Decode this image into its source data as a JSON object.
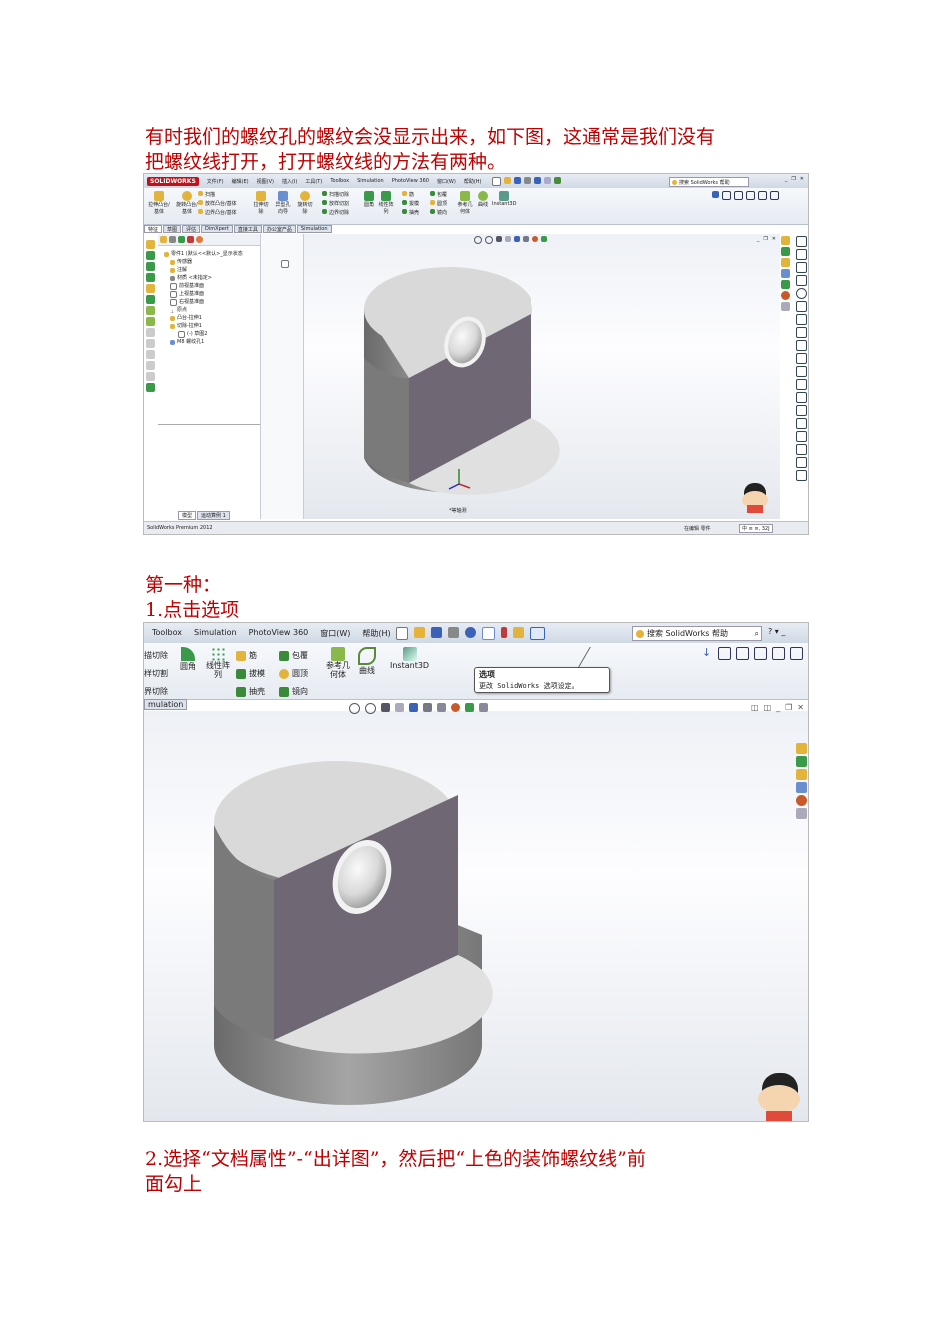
{
  "intro": {
    "line1": "有时我们的螺纹孔的螺纹会没显示出来，如下图，这通常是我们没有",
    "line2": "把螺纹线打开，打开螺纹线的方法有两种。"
  },
  "method1_title": "第一种：",
  "step1": "1.点击选项",
  "step2_line1": "2.选择“文档属性”-“出详图”，然后把“上色的装饰螺纹线”前",
  "step2_line2": "面勾上",
  "colors": {
    "text": "#c00000",
    "face_dark": "#6e6673",
    "cyl": "#8a8a8a"
  },
  "shot1": {
    "logo": "SOLIDWORKS",
    "menus": [
      "文件(F)",
      "编辑(E)",
      "视图(V)",
      "插入(I)",
      "工具(T)",
      "Toolbox",
      "Simulation",
      "PhotoView 360",
      "窗口(W)",
      "帮助(H)"
    ],
    "search": "搜索 SolidWorks 帮助",
    "ribbon": [
      "拉伸凸台/基体",
      "旋转凸台/基体",
      "扫描",
      "放样凸台/基体",
      "边界凸台/基体",
      "拉伸切除",
      "异型孔向导",
      "旋转切除",
      "扫描切除",
      "放样切割",
      "边界切除",
      "圆角",
      "线性阵列",
      "筋",
      "拔模",
      "抽壳",
      "包覆",
      "圆顶",
      "镜向",
      "参考几何体",
      "曲线",
      "Instant3D"
    ],
    "tabs": [
      "特征",
      "草图",
      "评估",
      "DimXpert",
      "直接工具",
      "办公室产品",
      "Simulation"
    ],
    "tree": [
      "零件1 (默认<<默认>_显示状态",
      "传感器",
      "注解",
      "材质 <未指定>",
      "前视基准面",
      "上视基准面",
      "右视基准面",
      "原点",
      "凸台-拉伸1",
      "切除-拉伸1",
      "(-) 草图2",
      "M8 螺纹孔1"
    ],
    "bottom_tabs": [
      "模型",
      "运动算例 1"
    ],
    "view_label": "*等轴测",
    "status_left": "SolidWorks Premium 2012",
    "status_right": [
      "在编辑 零件",
      "中 ≡ ≡, 32J"
    ]
  },
  "shot2": {
    "menus": [
      "Toolbox",
      "Simulation",
      "PhotoView 360",
      "窗口(W)",
      "帮助(H)"
    ],
    "search": "搜索 SolidWorks 帮助",
    "ribbon_left": [
      "描切除",
      "样切割",
      "界切除"
    ],
    "ribbon": [
      "圆角",
      "线性阵列",
      "筋",
      "拔模",
      "抽壳",
      "包覆",
      "圆顶",
      "镜向",
      "参考几何体",
      "曲线",
      "Instant3D"
    ],
    "tab": "mulation",
    "tooltip_title": "选项",
    "tooltip_body": "更改 SolidWorks 选项设定。"
  }
}
